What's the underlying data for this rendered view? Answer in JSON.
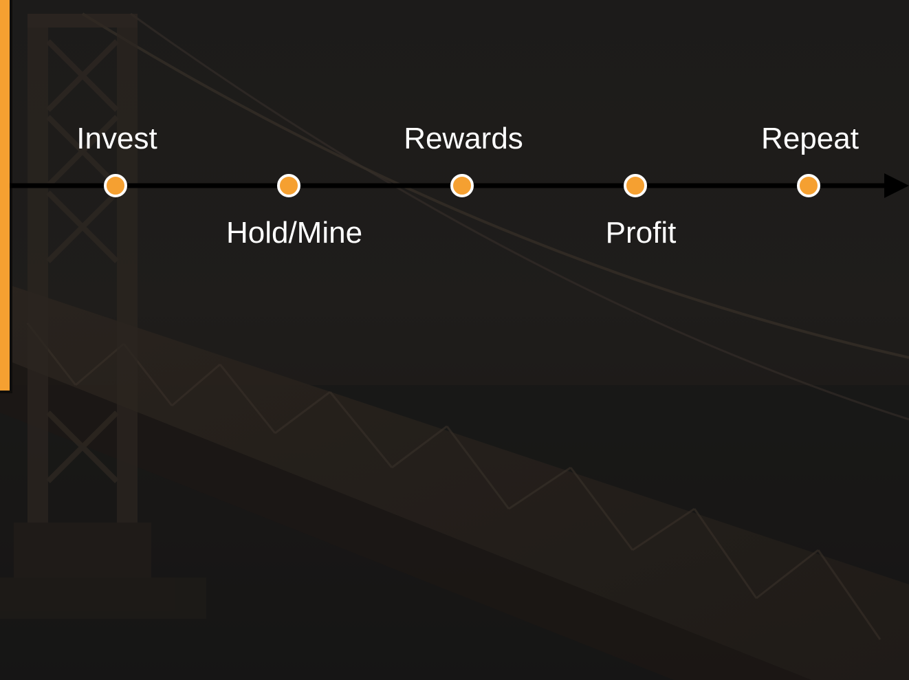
{
  "timeline": {
    "accent_color": "#F5A031",
    "line_color": "#000000",
    "steps": [
      {
        "label": "Invest",
        "position": "above"
      },
      {
        "label": "Hold/Mine",
        "position": "below"
      },
      {
        "label": "Rewards",
        "position": "above"
      },
      {
        "label": "Profit",
        "position": "below"
      },
      {
        "label": "Repeat",
        "position": "above"
      }
    ]
  },
  "background": {
    "description_icon": "suspension-bridge-photo"
  }
}
